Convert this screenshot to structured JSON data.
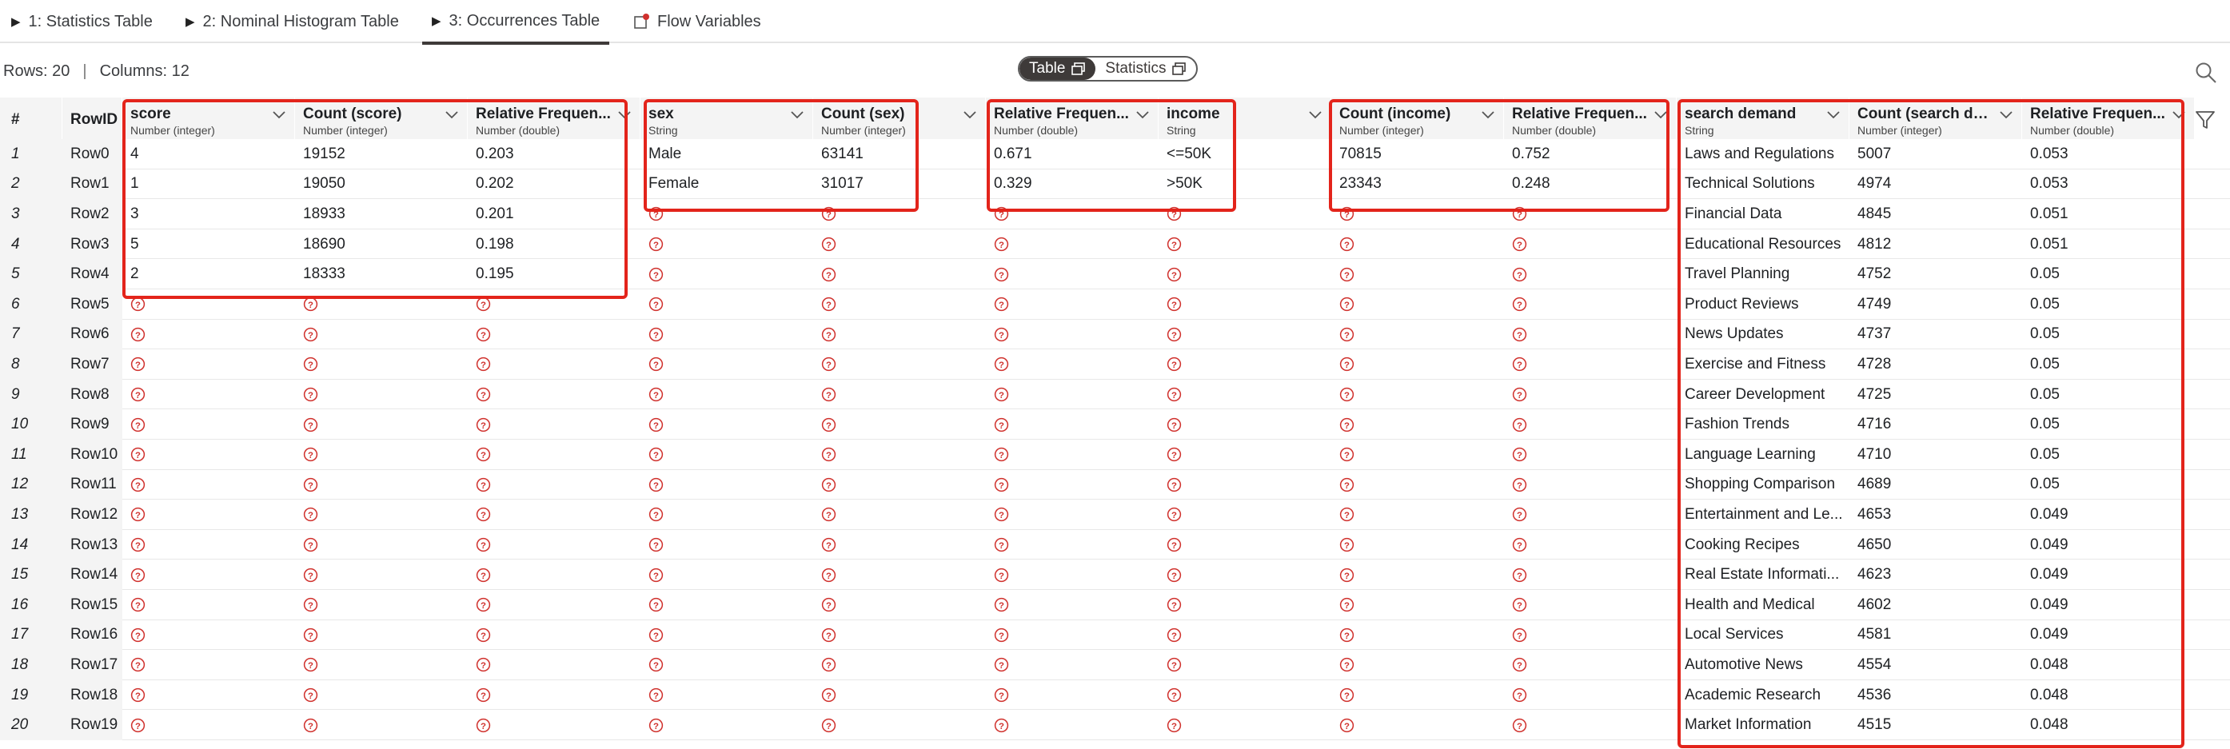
{
  "tabs": [
    {
      "label": "1: Statistics Table"
    },
    {
      "label": "2: Nominal Histogram Table"
    },
    {
      "label": "3: Occurrences Table"
    },
    {
      "label": "Flow Variables"
    }
  ],
  "info": {
    "rows": "Rows: 20",
    "separator": "|",
    "columns": "Columns: 12"
  },
  "view_toggle": {
    "table": "Table",
    "statistics": "Statistics"
  },
  "table": {
    "index_header": "#",
    "rowid_header": "RowID",
    "columns": [
      {
        "name": "score",
        "type": "Number (integer)"
      },
      {
        "name": "Count (score)",
        "type": "Number (integer)"
      },
      {
        "name": "Relative Frequen...",
        "type": "Number (double)"
      },
      {
        "name": "sex",
        "type": "String"
      },
      {
        "name": "Count (sex)",
        "type": "Number (integer)"
      },
      {
        "name": "Relative Frequen...",
        "type": "Number (double)"
      },
      {
        "name": "income",
        "type": "String"
      },
      {
        "name": "Count (income)",
        "type": "Number (integer)"
      },
      {
        "name": "Relative Frequen...",
        "type": "Number (double)"
      },
      {
        "name": "search demand",
        "type": "String"
      },
      {
        "name": "Count (search de...",
        "type": "Number (integer)"
      },
      {
        "name": "Relative Frequen...",
        "type": "Number (double)"
      }
    ],
    "rows": [
      {
        "index": "1",
        "rowid": "Row0",
        "cells": [
          "4",
          "19152",
          "0.203",
          "Male",
          "63141",
          "0.671",
          "<=50K",
          "70815",
          "0.752",
          "Laws and Regulations",
          "5007",
          "0.053"
        ]
      },
      {
        "index": "2",
        "rowid": "Row1",
        "cells": [
          "1",
          "19050",
          "0.202",
          "Female",
          "31017",
          "0.329",
          ">50K",
          "23343",
          "0.248",
          "Technical Solutions",
          "4974",
          "0.053"
        ]
      },
      {
        "index": "3",
        "rowid": "Row2",
        "cells": [
          "3",
          "18933",
          "0.201",
          null,
          null,
          null,
          null,
          null,
          null,
          "Financial Data",
          "4845",
          "0.051"
        ]
      },
      {
        "index": "4",
        "rowid": "Row3",
        "cells": [
          "5",
          "18690",
          "0.198",
          null,
          null,
          null,
          null,
          null,
          null,
          "Educational Resources",
          "4812",
          "0.051"
        ]
      },
      {
        "index": "5",
        "rowid": "Row4",
        "cells": [
          "2",
          "18333",
          "0.195",
          null,
          null,
          null,
          null,
          null,
          null,
          "Travel Planning",
          "4752",
          "0.05"
        ]
      },
      {
        "index": "6",
        "rowid": "Row5",
        "cells": [
          null,
          null,
          null,
          null,
          null,
          null,
          null,
          null,
          null,
          "Product Reviews",
          "4749",
          "0.05"
        ]
      },
      {
        "index": "7",
        "rowid": "Row6",
        "cells": [
          null,
          null,
          null,
          null,
          null,
          null,
          null,
          null,
          null,
          "News Updates",
          "4737",
          "0.05"
        ]
      },
      {
        "index": "8",
        "rowid": "Row7",
        "cells": [
          null,
          null,
          null,
          null,
          null,
          null,
          null,
          null,
          null,
          "Exercise and Fitness",
          "4728",
          "0.05"
        ]
      },
      {
        "index": "9",
        "rowid": "Row8",
        "cells": [
          null,
          null,
          null,
          null,
          null,
          null,
          null,
          null,
          null,
          "Career Development",
          "4725",
          "0.05"
        ]
      },
      {
        "index": "10",
        "rowid": "Row9",
        "cells": [
          null,
          null,
          null,
          null,
          null,
          null,
          null,
          null,
          null,
          "Fashion Trends",
          "4716",
          "0.05"
        ]
      },
      {
        "index": "11",
        "rowid": "Row10",
        "cells": [
          null,
          null,
          null,
          null,
          null,
          null,
          null,
          null,
          null,
          "Language Learning",
          "4710",
          "0.05"
        ]
      },
      {
        "index": "12",
        "rowid": "Row11",
        "cells": [
          null,
          null,
          null,
          null,
          null,
          null,
          null,
          null,
          null,
          "Shopping Comparison",
          "4689",
          "0.05"
        ]
      },
      {
        "index": "13",
        "rowid": "Row12",
        "cells": [
          null,
          null,
          null,
          null,
          null,
          null,
          null,
          null,
          null,
          "Entertainment and Le...",
          "4653",
          "0.049"
        ]
      },
      {
        "index": "14",
        "rowid": "Row13",
        "cells": [
          null,
          null,
          null,
          null,
          null,
          null,
          null,
          null,
          null,
          "Cooking Recipes",
          "4650",
          "0.049"
        ]
      },
      {
        "index": "15",
        "rowid": "Row14",
        "cells": [
          null,
          null,
          null,
          null,
          null,
          null,
          null,
          null,
          null,
          "Real Estate Informati...",
          "4623",
          "0.049"
        ]
      },
      {
        "index": "16",
        "rowid": "Row15",
        "cells": [
          null,
          null,
          null,
          null,
          null,
          null,
          null,
          null,
          null,
          "Health and Medical",
          "4602",
          "0.049"
        ]
      },
      {
        "index": "17",
        "rowid": "Row16",
        "cells": [
          null,
          null,
          null,
          null,
          null,
          null,
          null,
          null,
          null,
          "Local Services",
          "4581",
          "0.049"
        ]
      },
      {
        "index": "18",
        "rowid": "Row17",
        "cells": [
          null,
          null,
          null,
          null,
          null,
          null,
          null,
          null,
          null,
          "Automotive News",
          "4554",
          "0.048"
        ]
      },
      {
        "index": "19",
        "rowid": "Row18",
        "cells": [
          null,
          null,
          null,
          null,
          null,
          null,
          null,
          null,
          null,
          "Academic Research",
          "4536",
          "0.048"
        ]
      },
      {
        "index": "20",
        "rowid": "Row19",
        "cells": [
          null,
          null,
          null,
          null,
          null,
          null,
          null,
          null,
          null,
          "Market Information",
          "4515",
          "0.048"
        ]
      }
    ]
  },
  "colors": {
    "highlight": "#e3241b",
    "missing": "#d0312d",
    "header_bg": "#f4f4f4"
  },
  "icons": {
    "missing": "missing-value-icon",
    "sort": "chevron-down-icon",
    "search": "search-icon",
    "filter": "filter-icon"
  }
}
